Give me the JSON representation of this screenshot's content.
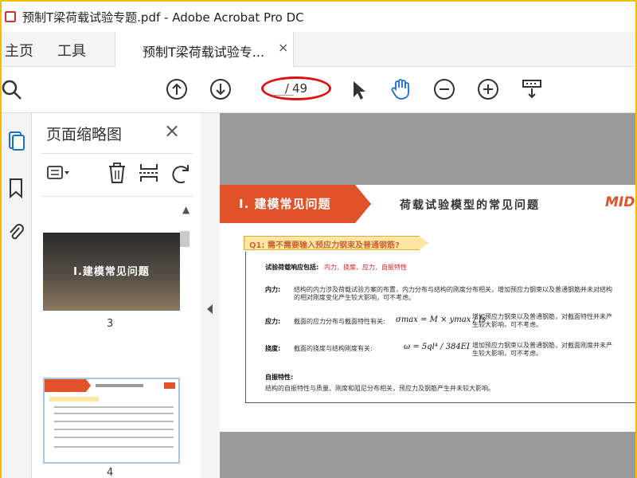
{
  "window": {
    "title": "预制T梁荷载试验专题.pdf - Adobe Acrobat Pro DC"
  },
  "tabs": {
    "home": "主页",
    "tools": "工具",
    "doc": "预制T梁荷载试验专...",
    "doc_close": "×"
  },
  "toolbar": {
    "page_sep": "/",
    "page_total": "49",
    "buttons": [
      "search-icon",
      "prev-page-icon",
      "next-page-icon",
      "select-pointer-icon",
      "hand-tool-icon",
      "zoom-out-icon",
      "zoom-in-icon",
      "scroll-mode-icon"
    ]
  },
  "thumbnail_panel": {
    "title": "页面缩略图",
    "close": "×",
    "thumbs": [
      {
        "page": "3",
        "title": "I.建模常见问题"
      },
      {
        "page": "4"
      }
    ]
  },
  "document": {
    "banner_title": "I. 建模常见问题",
    "banner_sub": "荷载试验模型的常见问题",
    "banner_logo": "MID",
    "question": "Q1: 需不需要输入预应力钢束及普通钢筋?",
    "response_label": "试验荷载响应包括:",
    "response_items": "内力、挠度、应力、自振特性",
    "internal_force_label": "内力:",
    "internal_force_text": "结构的内力涉及荷载试验方案的布置，内力分布与结构的刚度分布相关，增加预应力钢束以及普通钢筋并未对结构",
    "internal_force_text2": "的相对刚度变化产生较大影响，可不考虑。",
    "stress_label": "应力:",
    "stress_text": "截面的应力分布与截面特性有关:",
    "stress_note": "增加预应力钢束以及普通钢筋，对截面特性并未产",
    "stress_note2": "生较大影响，可不考虑。",
    "deflection_label": "挠度:",
    "deflection_text": "截面的挠度与结构刚度有关:",
    "deflection_note": "增加预应力钢束以及普通钢筋，对截面刚度并未产",
    "deflection_note2": "生较大影响，可不考虑。",
    "vibration_label": "自振特性:",
    "vibration_text": "结构的自振特性与质量、刚度和阻尼分布相关，预应力及钢筋产生并未较大影响。",
    "stress_formula": "σmax = M × ymax / Is",
    "deflection_formula": "ω = 5ql⁴ / 384EI"
  },
  "colors": {
    "accent_red": "#e0522a",
    "annotation": "#d11"
  }
}
